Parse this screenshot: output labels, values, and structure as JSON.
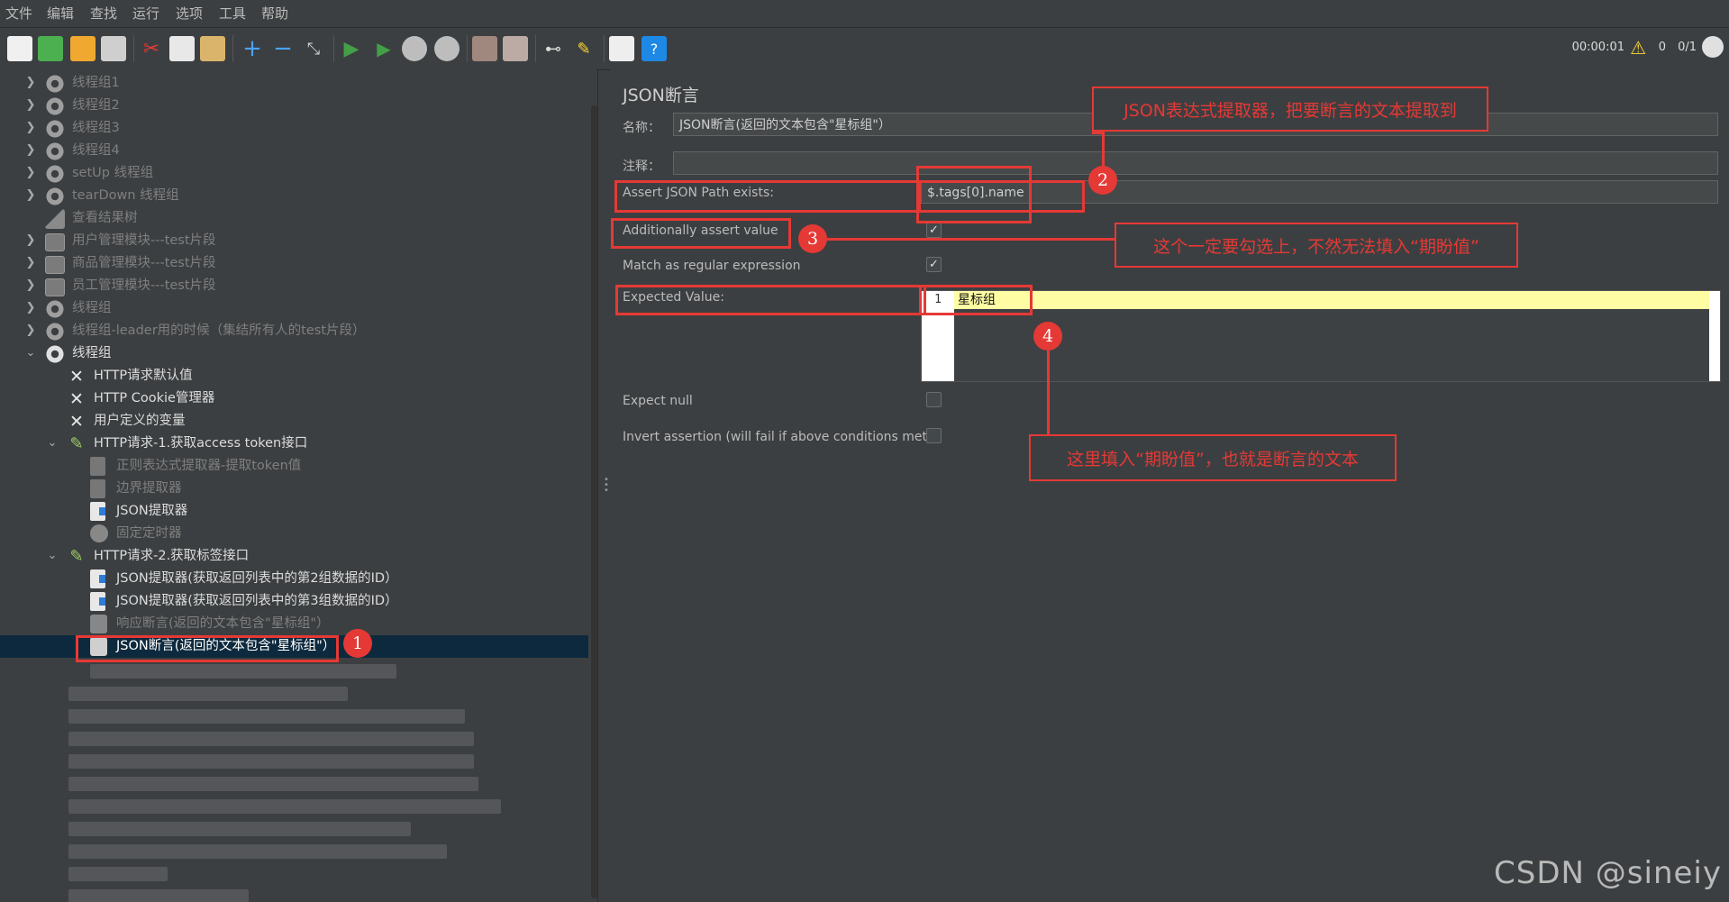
{
  "menu": [
    "文件",
    "编辑",
    "查找",
    "运行",
    "选项",
    "工具",
    "帮助"
  ],
  "toolbar_status": {
    "timer": "00:00:01",
    "warnings": "0",
    "threads": "0/1"
  },
  "tree": [
    {
      "label": "线程组1",
      "icon": "gear-icon"
    },
    {
      "label": "线程组2",
      "icon": "gear-icon"
    },
    {
      "label": "线程组3",
      "icon": "gear-icon"
    },
    {
      "label": "线程组4",
      "icon": "gear-icon"
    },
    {
      "label": "setUp 线程组",
      "icon": "gear-icon"
    },
    {
      "label": "tearDown 线程组",
      "icon": "gear-icon"
    },
    {
      "label": "查看结果树",
      "icon": "chart-icon"
    },
    {
      "label": "用户管理模块---test片段",
      "icon": "fragment-icon"
    },
    {
      "label": "商品管理模块---test片段",
      "icon": "fragment-icon"
    },
    {
      "label": "员工管理模块---test片段",
      "icon": "fragment-icon"
    },
    {
      "label": "线程组",
      "icon": "gear-icon"
    },
    {
      "label": "线程组-leader用的时候（集结所有人的test片段）",
      "icon": "gear-icon"
    },
    {
      "label": "线程组",
      "icon": "gear-icon"
    },
    {
      "label": "HTTP请求默认值",
      "icon": "wrench-icon"
    },
    {
      "label": "HTTP Cookie管理器",
      "icon": "wrench-icon"
    },
    {
      "label": "用户定义的变量",
      "icon": "wrench-icon"
    },
    {
      "label": "HTTP请求-1.获取access token接口",
      "icon": "pen-icon"
    },
    {
      "label": "正则表达式提取器-提取token值",
      "icon": "document-icon"
    },
    {
      "label": "边界提取器",
      "icon": "document-icon"
    },
    {
      "label": "JSON提取器",
      "icon": "document-icon"
    },
    {
      "label": "固定定时器",
      "icon": "clock-icon"
    },
    {
      "label": "HTTP请求-2.获取标签接口",
      "icon": "pen-icon"
    },
    {
      "label": "JSON提取器(获取返回列表中的第2组数据的ID）",
      "icon": "document-icon"
    },
    {
      "label": "JSON提取器(获取返回列表中的第3组数据的ID）",
      "icon": "document-icon"
    },
    {
      "label": "响应断言(返回的文本包含\"星标组\"）",
      "icon": "assertion-icon"
    },
    {
      "label": "JSON断言(返回的文本包含\"星标组\"）",
      "icon": "assertion-icon"
    }
  ],
  "panel": {
    "title": "JSON断言",
    "name_label": "名称：",
    "name_value": "JSON断言(返回的文本包含\"星标组\"）",
    "comment_label": "注释：",
    "comment_value": "",
    "assert_path_label": "Assert JSON Path exists:",
    "assert_path_value": "$.tags[0].name",
    "additionally_label": "Additionally assert value",
    "additionally_checked": true,
    "regex_label": "Match as regular expression",
    "regex_checked": true,
    "expected_label": "Expected Value:",
    "expected_line_number": "1",
    "expected_value": "星标组",
    "expect_null_label": "Expect null",
    "expect_null_checked": false,
    "invert_label": "Invert assertion (will fail if above conditions met)",
    "invert_checked": false
  },
  "annotations": {
    "badge1": "1",
    "badge2": "2",
    "badge3": "3",
    "badge4": "4",
    "callout2": "JSON表达式提取器，把要断言的文本提取到",
    "callout3": "这个一定要勾选上，不然无法填入“期盼值”",
    "callout4": "这里填入“期盼值”，也就是断言的文本",
    "color": "#e53935"
  },
  "watermark": "CSDN @sineiy"
}
